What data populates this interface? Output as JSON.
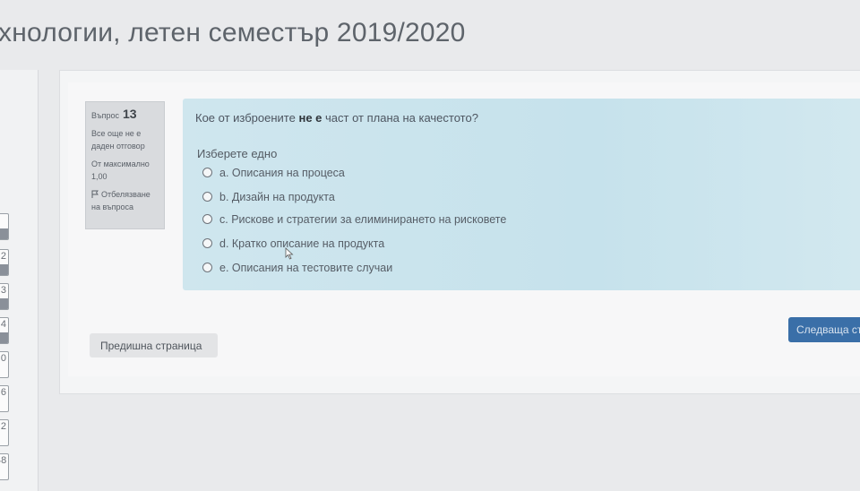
{
  "header": {
    "title": "хнологии, летен семестър 2019/2020"
  },
  "nav": {
    "numbers": [
      "",
      "2",
      "3",
      "4",
      "0",
      "6",
      "2",
      "48"
    ]
  },
  "info": {
    "question_label": "Въпрос",
    "question_number": "13",
    "status_line1": "Все още не е",
    "status_line2": "даден отговор",
    "max_line1": "От максимално",
    "max_line2": "1,00",
    "flag_line1": "Отбелязване",
    "flag_line2": "на въпроса"
  },
  "question": {
    "text_before": "Кое от изброените ",
    "text_bold": "не е",
    "text_after": " част от плана на качестото?",
    "prompt": "Изберете едно",
    "options": [
      "a. Описания на процеса",
      "b. Дизайн на продукта",
      "c. Рискове и стратегии за елиминирането на рисковете",
      "d. Кратко описание на продукта",
      "e. Описания на тестовите случаи"
    ]
  },
  "buttons": {
    "prev": "Предишна страница",
    "next": "Следваща стр"
  },
  "colors": {
    "question_bg": "#c6e2ec",
    "info_bg": "#d9dbde",
    "next_bg": "#3a6fa8"
  }
}
